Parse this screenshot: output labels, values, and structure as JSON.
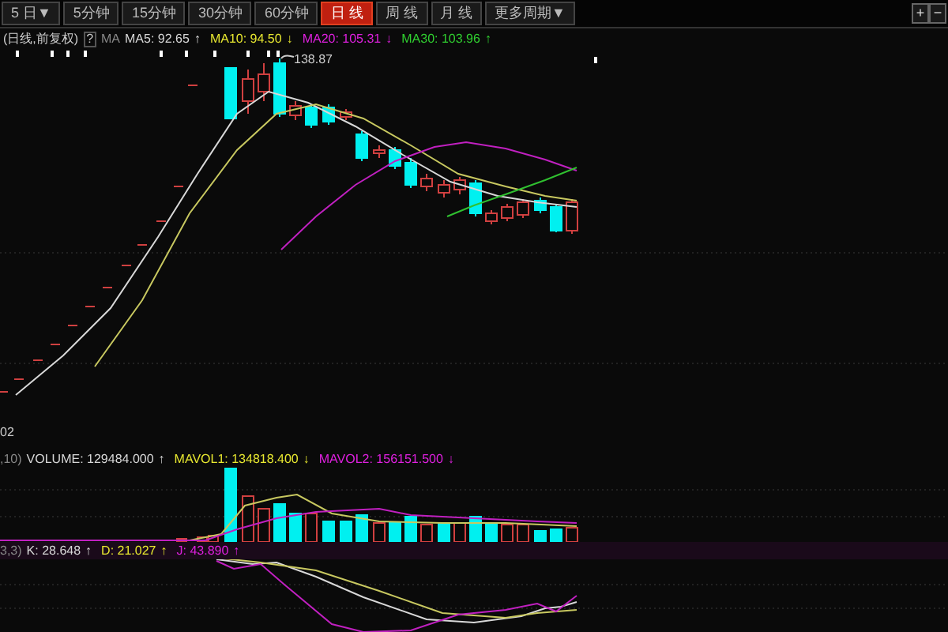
{
  "period_tabs": [
    {
      "label": "5 日▼",
      "selected": false
    },
    {
      "label": "5分钟",
      "selected": false
    },
    {
      "label": "15分钟",
      "selected": false
    },
    {
      "label": "30分钟",
      "selected": false
    },
    {
      "label": "60分钟",
      "selected": false
    },
    {
      "label": "日 线",
      "selected": true
    },
    {
      "label": "周 线",
      "selected": false
    },
    {
      "label": "月 线",
      "selected": false
    },
    {
      "label": "更多周期▼",
      "selected": false
    }
  ],
  "zoom_buttons": [
    "+",
    "−"
  ],
  "price_legend": {
    "adjustment": "(日线,前复权)",
    "help": "?",
    "indicator": "MA",
    "items": [
      {
        "label": "MA5: 92.65",
        "arrow": "↑",
        "color": "#d8d8d8"
      },
      {
        "label": "MA10: 94.50",
        "arrow": "↓",
        "color": "#e8e830"
      },
      {
        "label": "MA20: 105.31",
        "arrow": "↓",
        "color": "#e020e0"
      },
      {
        "label": "MA30: 103.96",
        "arrow": "↑",
        "color": "#30d030"
      }
    ]
  },
  "price_chart": {
    "high_label": "138.87",
    "axis_label": "02"
  },
  "volume_legend": {
    "params": ",10)",
    "items": [
      {
        "label": "VOLUME: 129484.000",
        "arrow": "↑",
        "color": "#d8d8d8"
      },
      {
        "label": "MAVOL1: 134818.400",
        "arrow": "↓",
        "color": "#e8e830"
      },
      {
        "label": "MAVOL2: 156151.500",
        "arrow": "↓",
        "color": "#e020e0"
      }
    ]
  },
  "kdj_legend": {
    "params": "3,3)",
    "items": [
      {
        "label": "K: 28.648",
        "arrow": "↑",
        "color": "#d8d8d8"
      },
      {
        "label": "D: 21.027",
        "arrow": "↑",
        "color": "#e8e830"
      },
      {
        "label": "J: 43.890",
        "arrow": "↑",
        "color": "#e020e0"
      }
    ]
  }
}
